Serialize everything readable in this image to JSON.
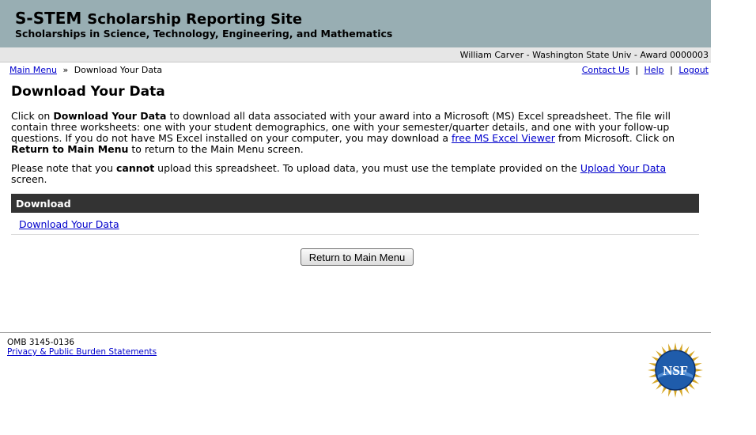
{
  "header": {
    "title_main": "S-STEM",
    "title_rest": "Scholarship Reporting Site",
    "subtitle": "Scholarships in Science, Technology, Engineering, and Mathematics"
  },
  "userbar": {
    "text": "William Carver - Washington State Univ - Award 0000003"
  },
  "breadcrumb": {
    "main_menu": "Main Menu",
    "separator": "»",
    "current": "Download Your Data"
  },
  "toplinks": {
    "contact": "Contact Us",
    "help": "Help",
    "logout": "Logout",
    "separator": "|"
  },
  "page": {
    "title": "Download Your Data",
    "p1_a": "Click on ",
    "p1_b": "Download Your Data",
    "p1_c": " to download all data associated with your award into a Microsoft (MS) Excel spreadsheet. The file will contain three worksheets: one with your student demographics, one with your semester/quarter details, and one with your follow-up questions. If you do not have MS Excel installed on your computer, you may download a ",
    "p1_link": "free MS Excel Viewer",
    "p1_d": " from Microsoft. Click on ",
    "p1_e": "Return to Main Menu",
    "p1_f": " to return to the Main Menu screen.",
    "p2_a": "Please note that you ",
    "p2_b": "cannot",
    "p2_c": " upload this spreadsheet. To upload data, you must use the template provided on the ",
    "p2_link": "Upload Your Data",
    "p2_d": " screen."
  },
  "download_table": {
    "header": "Download",
    "link": "Download Your Data"
  },
  "return_button": "Return to Main Menu",
  "footer": {
    "omb": "OMB 3145-0136",
    "privacy": "Privacy & Public Burden Statements"
  },
  "logo": {
    "text": "NSF",
    "colors": {
      "gold": "#d6a727",
      "blue": "#1f5cab",
      "dark_blue": "#0b2f6b"
    }
  }
}
